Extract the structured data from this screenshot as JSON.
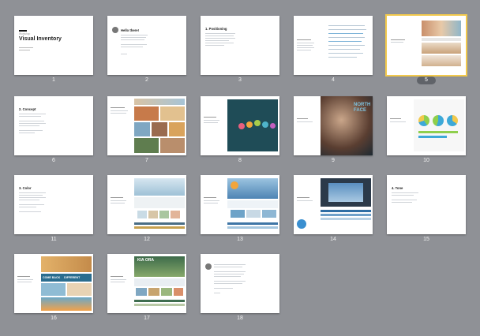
{
  "slides": [
    {
      "num": "1",
      "title": "Visual Inventory",
      "subtitle": "Workshop"
    },
    {
      "num": "2",
      "title": "Hello there!"
    },
    {
      "num": "3",
      "title": "1. Positioning"
    },
    {
      "num": "4"
    },
    {
      "num": "5"
    },
    {
      "num": "6",
      "title": "2. Concept"
    },
    {
      "num": "7"
    },
    {
      "num": "8"
    },
    {
      "num": "9",
      "overlay": "NORTH FACE"
    },
    {
      "num": "10"
    },
    {
      "num": "11",
      "title": "3. Color"
    },
    {
      "num": "12"
    },
    {
      "num": "13"
    },
    {
      "num": "14"
    },
    {
      "num": "15",
      "title": "4. Tone"
    },
    {
      "num": "16",
      "overlay": "COME BACK     DIFFERENT"
    },
    {
      "num": "17",
      "overlay": "KIA ORA"
    },
    {
      "num": "18"
    }
  ],
  "selected_slide": "5",
  "colors": {
    "background": "#8f9196",
    "selection": "#f2c94c",
    "badge": "#606369"
  }
}
